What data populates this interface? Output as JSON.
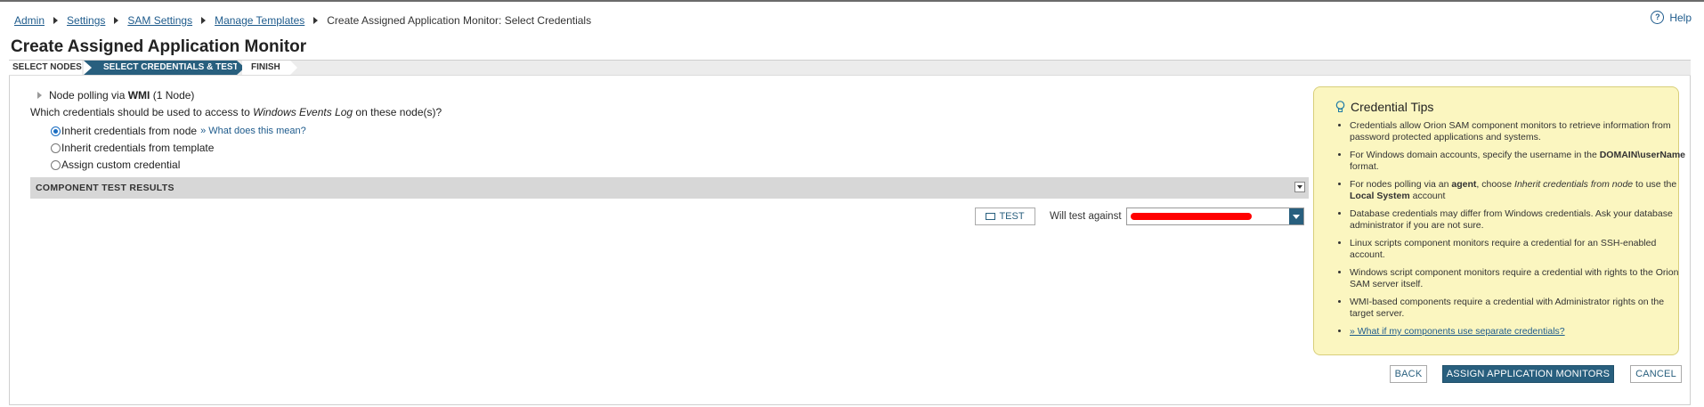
{
  "breadcrumb": {
    "items": [
      "Admin",
      "Settings",
      "SAM Settings",
      "Manage Templates"
    ],
    "current": "Create Assigned Application Monitor: Select Credentials"
  },
  "help": {
    "label": "Help",
    "icon": "help-circle-icon"
  },
  "page": {
    "title": "Create Assigned Application Monitor"
  },
  "wizard": {
    "steps": [
      {
        "label": "SELECT NODES",
        "state": "done"
      },
      {
        "label": "SELECT CREDENTIALS & TEST",
        "state": "active"
      },
      {
        "label": "FINISH",
        "state": "pending"
      }
    ]
  },
  "polling": {
    "prefix": "Node polling via ",
    "method": "WMI",
    "count": "(1 Node)"
  },
  "question": {
    "prefix": "Which credentials should be used to access to ",
    "target": "Windows Events Log",
    "suffix": " on these node(s)?"
  },
  "credentials": {
    "options": [
      {
        "label": "Inherit credentials from node",
        "checked": true
      },
      {
        "label": "Inherit credentials from template",
        "checked": false
      },
      {
        "label": "Assign custom credential",
        "checked": false
      }
    ],
    "help_link": "» What does this mean?"
  },
  "results": {
    "title": "COMPONENT TEST RESULTS",
    "test_button": "TEST",
    "will_test_label": "Will test against",
    "selected_node": ""
  },
  "tips": {
    "title": "Credential Tips",
    "icon": "lightbulb-icon",
    "items": [
      {
        "parts": [
          [
            "Credentials allow Orion SAM component monitors to retrieve information from password protected applications and systems.",
            ""
          ]
        ]
      },
      {
        "parts": [
          [
            "For Windows domain accounts, specify the username in the ",
            ""
          ],
          [
            "DOMAIN\\userName",
            "b"
          ],
          [
            " format.",
            ""
          ]
        ]
      },
      {
        "parts": [
          [
            "For nodes polling via an ",
            ""
          ],
          [
            "agent",
            "b"
          ],
          [
            ", choose ",
            ""
          ],
          [
            "Inherit credentials from node",
            "i"
          ],
          [
            " to use the ",
            ""
          ],
          [
            "Local System",
            "b"
          ],
          [
            " account",
            ""
          ]
        ]
      },
      {
        "parts": [
          [
            "Database credentials may differ from Windows credentials. Ask your database administrator if you are not sure.",
            ""
          ]
        ]
      },
      {
        "parts": [
          [
            "Linux scripts component monitors require a credential for an SSH-enabled account.",
            ""
          ]
        ]
      },
      {
        "parts": [
          [
            "Windows script component monitors require a credential with rights to the Orion SAM server itself.",
            ""
          ]
        ]
      },
      {
        "parts": [
          [
            "WMI-based components require a credential with Administrator rights on the target server.",
            ""
          ]
        ]
      },
      {
        "parts": [
          [
            "» What if my components use separate credentials?",
            "a"
          ]
        ]
      }
    ]
  },
  "footer": {
    "back": "BACK",
    "assign": "ASSIGN APPLICATION MONITORS",
    "cancel": "CANCEL"
  },
  "colors": {
    "accent": "#285f7e",
    "link": "#1e5b8c",
    "tips_background": "#fbf6c0",
    "redaction": "#ff0000"
  }
}
